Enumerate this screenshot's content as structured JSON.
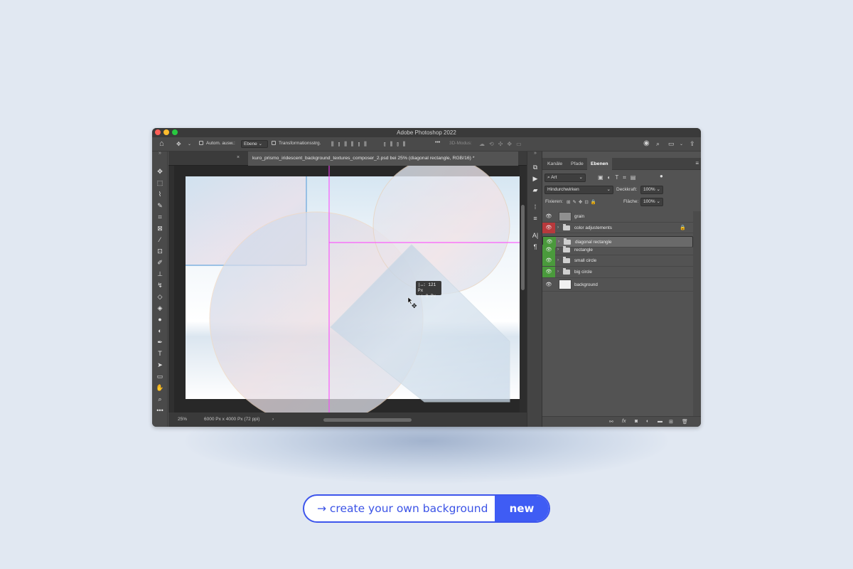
{
  "window": {
    "title": "Adobe Photoshop 2022"
  },
  "options_bar": {
    "auto_select_label": "Autom. ausw.:",
    "auto_select_value": "Ebene",
    "transform_label": "Transformationsstrg.",
    "more_label": "•••",
    "mode_3d_label": "3D-Modus:"
  },
  "document": {
    "tab_title": "kuro_prismo_iridescent_background_textures_composer_2.psd bei 25% (diagonal rectangle, RGB/16) *",
    "measure_line1": "|↔: 121 Px",
    "measure_line2": "↕:     0 Px"
  },
  "status_bar": {
    "zoom": "25%",
    "doc_size": "6000 Px x 4000 Px (72 ppi)",
    "arrow": "›"
  },
  "layers_panel": {
    "tabs": [
      "Kanäle",
      "Pfade",
      "Ebenen"
    ],
    "active_tab": "Ebenen",
    "filter_label": "Art",
    "blend_mode": "Hindurchwirken",
    "opacity_label": "Deckkraft:",
    "opacity_value": "100%",
    "lock_label": "Fixieren:",
    "fill_label": "Fläche:",
    "fill_value": "100%",
    "layers": [
      {
        "name": "grain",
        "type": "layer",
        "color": ""
      },
      {
        "name": "color adjustements",
        "type": "group",
        "color": "#b8393c",
        "locked": true
      },
      {
        "name": "diagonal rectangle",
        "type": "group",
        "color": "#4a9a3c",
        "selected": true
      },
      {
        "name": "rectangle",
        "type": "group",
        "color": "#4a9a3c"
      },
      {
        "name": "small circle",
        "type": "group",
        "color": "#4a9a3c"
      },
      {
        "name": "big circle",
        "type": "group",
        "color": "#4a9a3c"
      },
      {
        "name": "background",
        "type": "layer",
        "color": ""
      }
    ]
  },
  "cta": {
    "text": "→ create your own background",
    "badge": "new"
  },
  "colors": {
    "accent": "#3f5cf4",
    "guide": "#ff3cff",
    "label_red": "#b8393c",
    "label_green": "#4a9a3c"
  }
}
